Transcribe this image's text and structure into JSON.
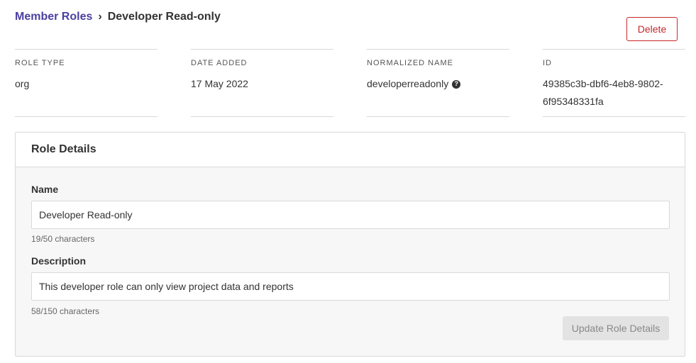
{
  "breadcrumb": {
    "parent": "Member Roles",
    "separator": "›",
    "current": "Developer Read-only"
  },
  "actions": {
    "delete_label": "Delete"
  },
  "meta": [
    {
      "label": "ROLE TYPE",
      "value": "org"
    },
    {
      "label": "DATE ADDED",
      "value": "17 May 2022"
    },
    {
      "label": "NORMALIZED NAME",
      "value": "developerreadonly"
    },
    {
      "label": "ID",
      "value": "49385c3b-dbf6-4eb8-9802-6f95348331fa"
    }
  ],
  "role_details": {
    "title": "Role Details",
    "name_label": "Name",
    "name_value": "Developer Read-only",
    "name_count": "19/50 characters",
    "description_label": "Description",
    "description_value": "This developer role can only view project data and reports",
    "description_count": "58/150 characters",
    "update_label": "Update Role Details"
  },
  "colors": {
    "link": "#4b3fa0",
    "danger": "#c62828"
  }
}
